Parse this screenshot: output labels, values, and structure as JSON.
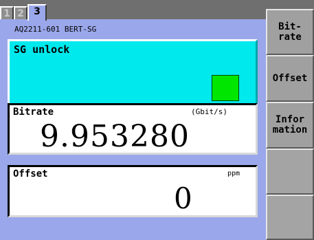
{
  "tabs": [
    {
      "label": "1",
      "active": false
    },
    {
      "label": "2",
      "active": false
    },
    {
      "label": "3",
      "active": true
    }
  ],
  "device": {
    "title": "AQ2211-601 BERT-SG"
  },
  "sg_status": {
    "label": "SG unlock",
    "indicator_color": "#00e600"
  },
  "bitrate": {
    "label": "Bitrate",
    "unit": "(Gbit/s)",
    "value": "9.953280"
  },
  "offset": {
    "label": "Offset",
    "unit": "ppm",
    "value": "0"
  },
  "softkeys": [
    {
      "label": "Bit-\nrate"
    },
    {
      "label": "Offset"
    },
    {
      "label": "Infor\nmation"
    },
    {
      "label": ""
    },
    {
      "label": ""
    }
  ],
  "colors": {
    "panel_bg": "#9aa7ea",
    "status_box_bg": "#00e9ed",
    "indicator_green": "#00e600",
    "softkey_bg": "#a0a0a0"
  }
}
